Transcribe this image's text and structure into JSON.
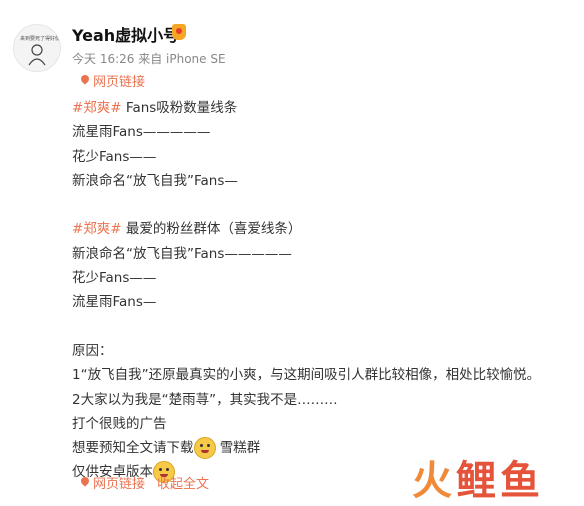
{
  "header": {
    "username": "Yeah虚拟小号",
    "meta": "今天 16:26 来自 iPhone SE",
    "avatar_caption": "来到要死了得好像",
    "link_label": "网页链接"
  },
  "post": {
    "lines": [
      {
        "tag": "#郑爽#",
        "text": " Fans吸粉数量线条"
      },
      {
        "text": "流星雨Fans—————"
      },
      {
        "text": "花少Fans——"
      },
      {
        "text": "新浪命名“放飞自我”Fans—"
      },
      {
        "blank": true
      },
      {
        "tag": "#郑爽#",
        "text": " 最爱的粉丝群体（喜爱线条）"
      },
      {
        "text": "新浪命名“放飞自我”Fans—————"
      },
      {
        "text": "花少Fans——"
      },
      {
        "text": "流星雨Fans—"
      },
      {
        "blank": true
      },
      {
        "text": "原因："
      },
      {
        "text": "1“放飞自我”还原最真实的小爽，与这期间吸引人群比较相像，相处比较愉悦。"
      },
      {
        "text": "2大家以为我是“楚雨荨”，其实我不是………"
      },
      {
        "text": "打个很贱的广告"
      },
      {
        "text": "想要预知全文请下载",
        "emoji": "angry-emoji",
        "after": " 雪糕群"
      },
      {
        "text": "仅供安卓版本",
        "emoji": "smile-emoji"
      }
    ]
  },
  "footer": {
    "link_label": "网页链接",
    "collapse_label": "收起全文"
  },
  "watermark": {
    "left": "火",
    "right": "鲤鱼"
  },
  "colors": {
    "accent": "#eb7350",
    "text": "#333333",
    "meta": "#888888"
  }
}
